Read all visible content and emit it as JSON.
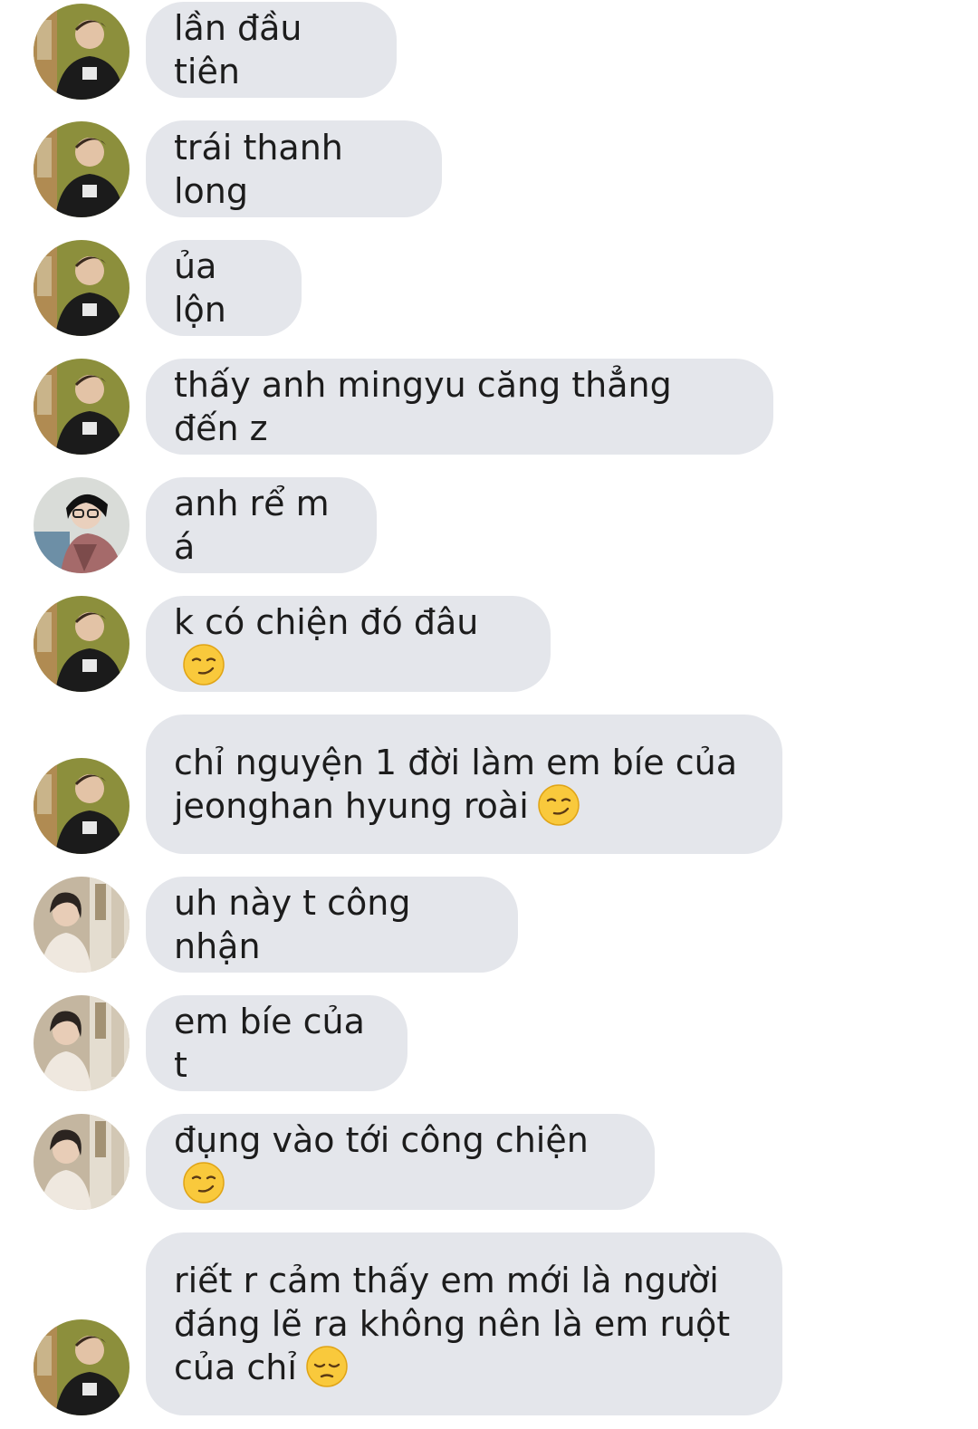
{
  "messages": [
    {
      "text": "lần đầu tiên",
      "avatar": "person-a-avatar",
      "emoji": ""
    },
    {
      "text": "trái thanh long",
      "avatar": "person-a-avatar",
      "emoji": ""
    },
    {
      "text": "ủa lộn",
      "avatar": "person-a-avatar",
      "emoji": ""
    },
    {
      "text": "thấy anh mingyu căng thẳng đến z",
      "avatar": "person-a-avatar",
      "emoji": ""
    },
    {
      "text": "anh rể m á",
      "avatar": "person-b-avatar",
      "emoji": ""
    },
    {
      "text": "k có chiện đó đâu",
      "avatar": "person-a-avatar",
      "emoji": "smirking-face-emoji"
    },
    {
      "text": "chỉ nguyện 1 đời làm em bíe của\njeonghan hyung roài",
      "avatar": "person-a-avatar",
      "emoji": "smirking-face-emoji"
    },
    {
      "text": "uh này t công nhận",
      "avatar": "person-c-avatar",
      "emoji": ""
    },
    {
      "text": "em bíe của t",
      "avatar": "person-c-avatar",
      "emoji": ""
    },
    {
      "text": "đụng vào tới công chiện",
      "avatar": "person-c-avatar",
      "emoji": "smirking-face-emoji"
    },
    {
      "text": "riết r cảm thấy em mới là người\nđáng lẽ ra không nên là em ruột\ncủa chỉ",
      "avatar": "person-a-avatar",
      "emoji": "pensive-face-emoji"
    }
  ],
  "colors": {
    "bubble": "#e4e6eb",
    "text": "#1c1c1c",
    "background": "#ffffff"
  }
}
